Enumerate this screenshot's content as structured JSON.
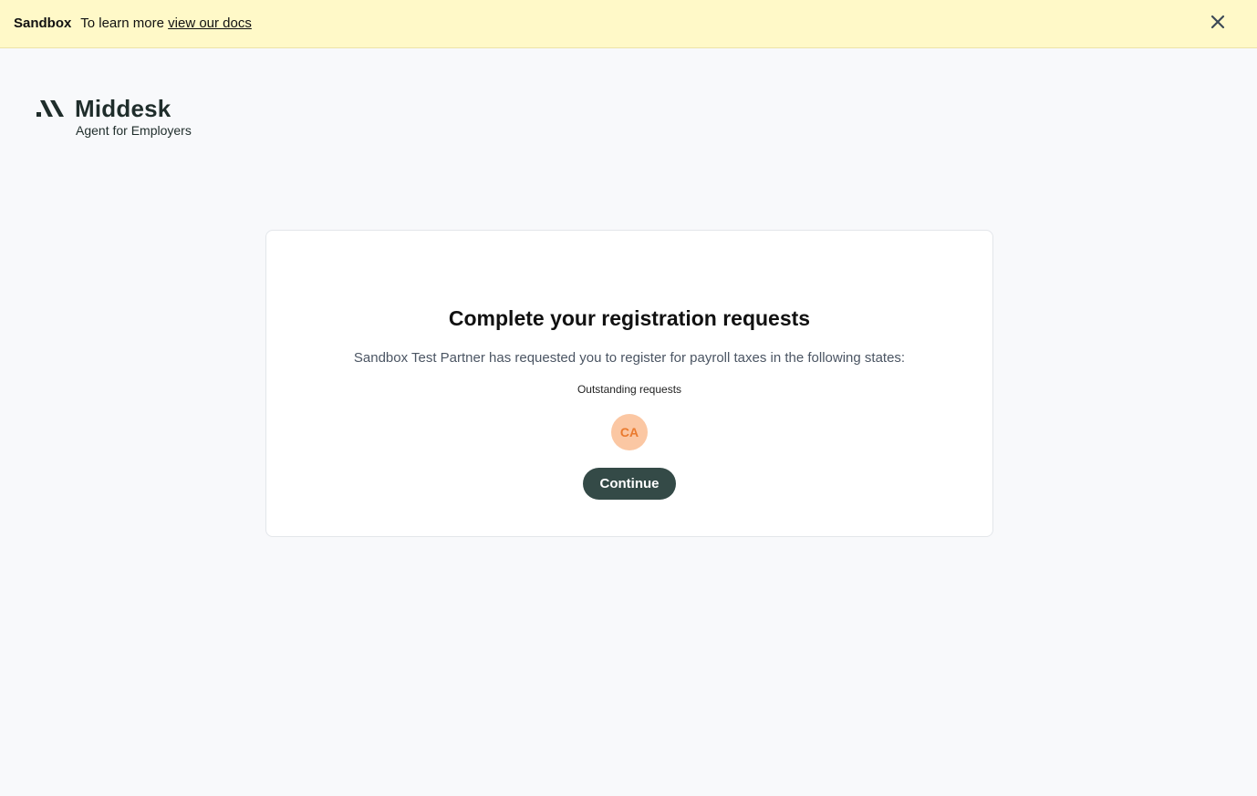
{
  "banner": {
    "label": "Sandbox",
    "text": "To learn more",
    "link_text": "view our docs",
    "close_icon": "close-icon"
  },
  "brand": {
    "logo_icon": "middesk-logo-icon",
    "name": "Middesk",
    "tagline": "Agent for Employers"
  },
  "card": {
    "title": "Complete your registration requests",
    "description": "Sandbox Test Partner has requested you to register for payroll taxes in the following states:",
    "subheading": "Outstanding requests",
    "states": [
      "CA"
    ],
    "continue_label": "Continue"
  },
  "colors": {
    "banner_bg": "#fff9c8",
    "page_bg": "#f8f9fb",
    "button_bg": "#344a47",
    "badge_bg": "#fbc7a3",
    "badge_text": "#ea7a2e"
  }
}
